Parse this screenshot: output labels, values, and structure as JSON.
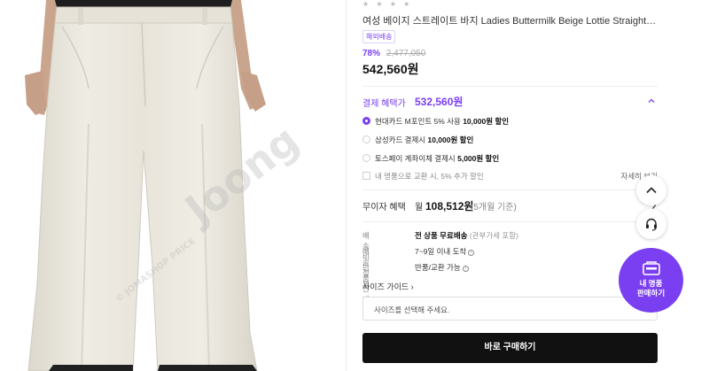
{
  "product": {
    "rating_stars": "★ ★ ★ ★",
    "title": "여성 베이지 스트레이트 바지 Ladies Buttermilk Beige Lottie Straight-Leg Trous...",
    "badge": "해외배송",
    "discount_rate": "78%",
    "original_price": "2,477,050",
    "price": "542,560원"
  },
  "image": {
    "watermark_main": "Joong",
    "watermark_small": "© JOMASHOP PRICE"
  },
  "benefits": {
    "label": "결제 혜택가",
    "amount": "532,560원",
    "options": [
      {
        "text_prefix": "현대카드 M포인트 5% 사용 ",
        "text_bold": "10,000원 할인",
        "selected": true
      },
      {
        "text_prefix": "삼성카드 결제시 ",
        "text_bold": "10,000원 할인",
        "selected": false
      },
      {
        "text_prefix": "토스페이 계좌이체 결제시 ",
        "text_bold": "5,000원 할인",
        "selected": false
      }
    ],
    "trade_in_text": "내 명품으로 교환 시, 5% 추가 할인",
    "trade_in_more": "자세히 보기"
  },
  "installment": {
    "label": "무이자 혜택",
    "won": "월",
    "amount": "108,512원",
    "months": "(5개월 기준)"
  },
  "shipping": {
    "fee_label": "배송비",
    "fee_bold": "전 상품 무료배송",
    "fee_sub": "(관부가세 포함)",
    "info_label": "배송정보",
    "info_value": "7~9일 이내 도착",
    "guide_label": "반품안내",
    "guide_value": "반품/교환 가능"
  },
  "size": {
    "guide": "사이즈 가이드 ›",
    "placeholder": "사이즈를 선택해 주세요."
  },
  "buy_button": "바로 구매하기",
  "fab": {
    "sell_line1": "내 명품",
    "sell_line2": "판매하기"
  },
  "colors": {
    "accent": "#7b3ff2",
    "buy_button": "#111111",
    "pants": "#ebe7dd"
  }
}
